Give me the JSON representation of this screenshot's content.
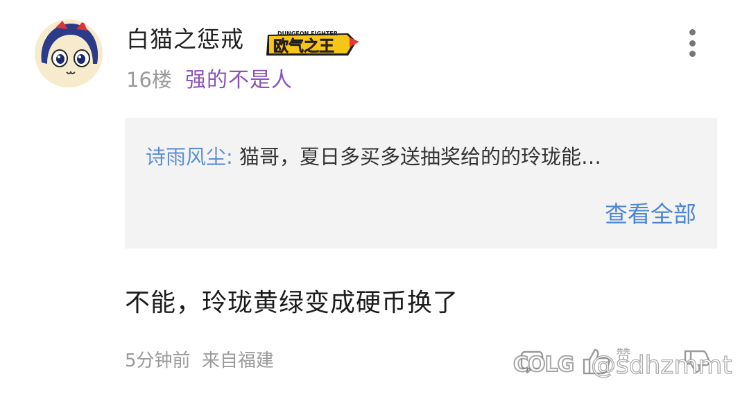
{
  "post": {
    "author": {
      "name": "白猫之惩戒",
      "badge_text": "欧气之王",
      "badge_subtext": "DUNGEON FIGHTER",
      "avatar": "anime-girl-avatar"
    },
    "floor": "16楼",
    "floor_tag": "强的不是人",
    "quote": {
      "author": "诗雨风尘:",
      "text": "猫哥，夏日多买多送抽奖给的的玲珑能…",
      "view_all": "查看全部"
    },
    "body": "不能，玲珑黄绿变成硬币换了",
    "time": "5分钟前",
    "location": "来自福建"
  },
  "actions": {
    "more_icon": "more-vertical-icon",
    "reply_icon": "reply-icon",
    "like_icon": "thumbs-up-icon",
    "like_label": "赞",
    "dislike_icon": "thumbs-down-icon"
  },
  "watermark": {
    "logo": "COLG",
    "handle": "@sdhzmmt"
  },
  "colors": {
    "floor_tag": "#8a52b8",
    "quote_author": "#5b8fd6",
    "link": "#4e86d2",
    "quote_bg": "#f3f3f3",
    "muted": "#9a9a9a"
  }
}
